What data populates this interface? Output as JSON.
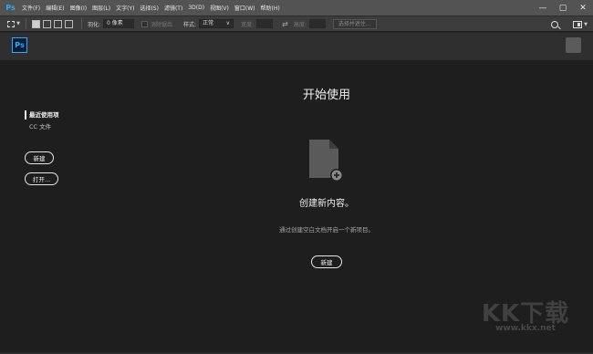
{
  "menubar": {
    "app_logo": "Ps",
    "items": [
      "文件(F)",
      "编辑(E)",
      "图像(I)",
      "图层(L)",
      "文字(Y)",
      "选择(S)",
      "滤镜(T)",
      "3D(D)",
      "视图(V)",
      "窗口(W)",
      "帮助(H)"
    ],
    "window_buttons": [
      "—",
      "▢",
      "✕"
    ]
  },
  "optionsbar": {
    "feather_label": "羽化:",
    "feather_value": "0 像素",
    "antialias_label": "消除锯齿",
    "style_label": "样式:",
    "style_value": "正常",
    "width_label": "宽度:",
    "height_label": "高度:",
    "select_mask_button": "选择并遮住..."
  },
  "start_header": {
    "logo": "Ps"
  },
  "sidebar": {
    "recent": "最近使用项",
    "cc_files": "CC 文件",
    "new_button": "新建",
    "open_button": "打开..."
  },
  "main": {
    "title": "开始使用",
    "create_title": "创建新内容。",
    "create_desc": "通过创建空白文档开启一个新项目。",
    "new_button": "新建"
  },
  "watermark": {
    "brand": "KK下载",
    "url": "www.kkx.net"
  }
}
